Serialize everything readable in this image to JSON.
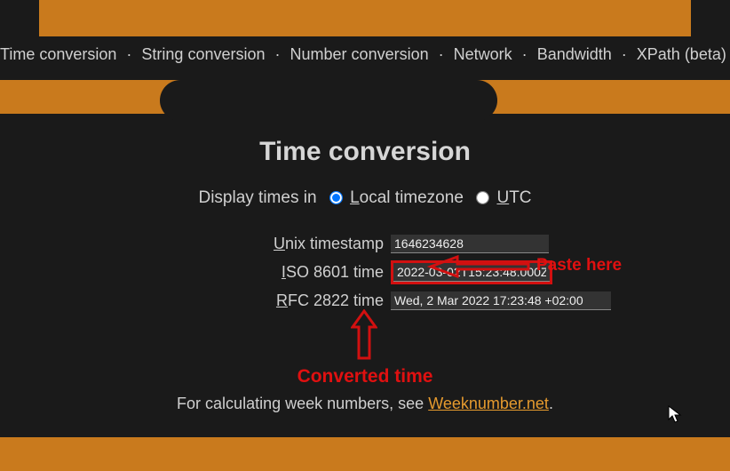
{
  "nav": {
    "items": [
      "Time conversion",
      "String conversion",
      "Number conversion",
      "Network",
      "Bandwidth",
      "XPath (beta)"
    ]
  },
  "title": "Time conversion",
  "timezone": {
    "label_prefix": "Display times in",
    "local_u": "L",
    "local_rest": "ocal timezone",
    "utc_u": "U",
    "utc_rest": "TC",
    "selected": "local"
  },
  "fields": {
    "unix": {
      "label_u": "U",
      "label_rest": "nix timestamp",
      "value": "1646234628"
    },
    "iso": {
      "label_u": "I",
      "label_rest": "SO 8601 time",
      "value": "2022-03-02T15:23:48.000Z"
    },
    "rfc": {
      "label_u": "R",
      "label_rest": "FC 2822 time",
      "value": "Wed, 2 Mar 2022 17:23:48 +02:00"
    }
  },
  "annotations": {
    "paste": "Paste here",
    "converted": "Converted time"
  },
  "weeknote": {
    "prefix": "For calculating week numbers, see ",
    "link_text": "Weeknumber.net",
    "suffix": "."
  }
}
